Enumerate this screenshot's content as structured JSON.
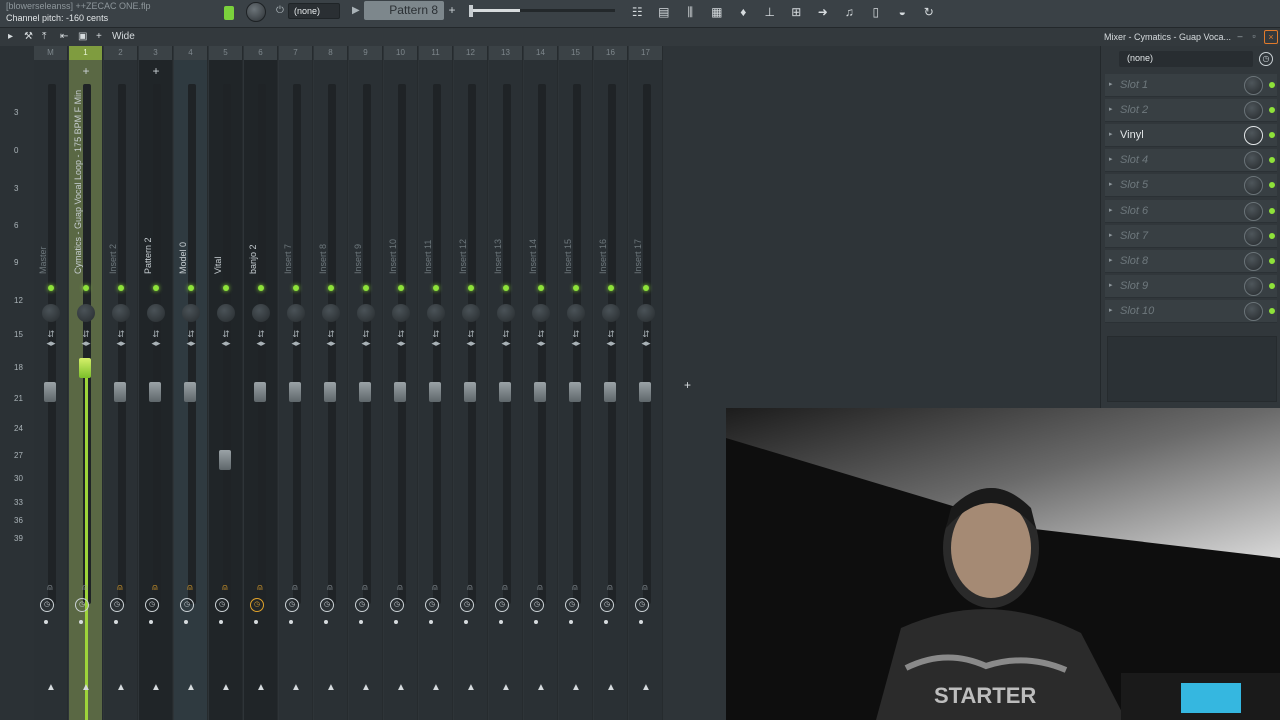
{
  "app": {
    "file_title": "[blowerseleanss] ++ZECAC ONE.flp",
    "hint": "Channel pitch: -160 cents"
  },
  "toolbar": {
    "pattern_select": "(none)",
    "pattern_label": "Pattern 8",
    "pattern_add": "+",
    "icons": [
      "playlist-icon",
      "piano-roll-icon",
      "mixer-icon",
      "channel-rack-icon",
      "plugin-icon",
      "tempo-tap-icon",
      "browser-icon",
      "arrow-icon",
      "mic-icon",
      "file-icon",
      "hat-icon",
      "refresh-icon"
    ]
  },
  "mixer_bar": {
    "wide_label": "Wide",
    "title": "Mixer - Cymatics - Guap Voca..."
  },
  "meter_scale": [
    "3",
    "0",
    "3",
    "6",
    "9",
    "12",
    "15",
    "18",
    "21",
    "24",
    "27",
    "30",
    "33",
    "36",
    "39"
  ],
  "strips": [
    {
      "num": "M",
      "name": "Master",
      "style": "normal",
      "dim": true,
      "rec": false,
      "clock": false
    },
    {
      "num": "1",
      "name": "Cymatics - Guap Vocal Loop - 175 BPM F Min",
      "style": "selected",
      "dim": false,
      "rec": false,
      "clock": false
    },
    {
      "num": "2",
      "name": "Insert 2",
      "style": "normal",
      "dim": true,
      "rec": true,
      "clock": false
    },
    {
      "num": "3",
      "name": "Pattern 2",
      "style": "dark",
      "dim": false,
      "rec": true,
      "clock": false
    },
    {
      "num": "4",
      "name": "Model 0",
      "style": "blue",
      "dim": false,
      "rec": true,
      "clock": false
    },
    {
      "num": "5",
      "name": "Vital",
      "style": "dark",
      "dim": false,
      "rec": true,
      "clock": false
    },
    {
      "num": "6",
      "name": "banjo 2",
      "style": "dark",
      "dim": false,
      "rec": true,
      "clock": true
    },
    {
      "num": "7",
      "name": "Insert 7",
      "style": "normal",
      "dim": true,
      "rec": false,
      "clock": false
    },
    {
      "num": "8",
      "name": "Insert 8",
      "style": "normal",
      "dim": true,
      "rec": false,
      "clock": false
    },
    {
      "num": "9",
      "name": "Insert 9",
      "style": "normal",
      "dim": true,
      "rec": false,
      "clock": false
    },
    {
      "num": "10",
      "name": "Insert 10",
      "style": "normal",
      "dim": true,
      "rec": false,
      "clock": false
    },
    {
      "num": "11",
      "name": "Insert 11",
      "style": "normal",
      "dim": true,
      "rec": false,
      "clock": false
    },
    {
      "num": "12",
      "name": "Insert 12",
      "style": "normal",
      "dim": true,
      "rec": false,
      "clock": false
    },
    {
      "num": "13",
      "name": "Insert 13",
      "style": "normal",
      "dim": true,
      "rec": false,
      "clock": false
    },
    {
      "num": "14",
      "name": "Insert 14",
      "style": "normal",
      "dim": true,
      "rec": false,
      "clock": false
    },
    {
      "num": "15",
      "name": "Insert 15",
      "style": "normal",
      "dim": true,
      "rec": false,
      "clock": false
    },
    {
      "num": "16",
      "name": "Insert 16",
      "style": "normal",
      "dim": true,
      "rec": false,
      "clock": false
    },
    {
      "num": "17",
      "name": "Insert 17",
      "style": "normal",
      "dim": true,
      "rec": false,
      "clock": false
    }
  ],
  "fx_panel": {
    "preset": "(none)",
    "slots": [
      {
        "label": "Slot 1",
        "active": false
      },
      {
        "label": "Slot 2",
        "active": false
      },
      {
        "label": "Vinyl",
        "active": true
      },
      {
        "label": "Slot 4",
        "active": false
      },
      {
        "label": "Slot 5",
        "active": false
      },
      {
        "label": "Slot 6",
        "active": false
      },
      {
        "label": "Slot 7",
        "active": false
      },
      {
        "label": "Slot 8",
        "active": false
      },
      {
        "label": "Slot 9",
        "active": false
      },
      {
        "label": "Slot 10",
        "active": false
      }
    ]
  },
  "webcam": {
    "shirt_text": "STARTER"
  },
  "colors": {
    "accent_green": "#8ee23a",
    "selected_strip": "#7f9c3f",
    "close_orange": "#e07a2b"
  }
}
